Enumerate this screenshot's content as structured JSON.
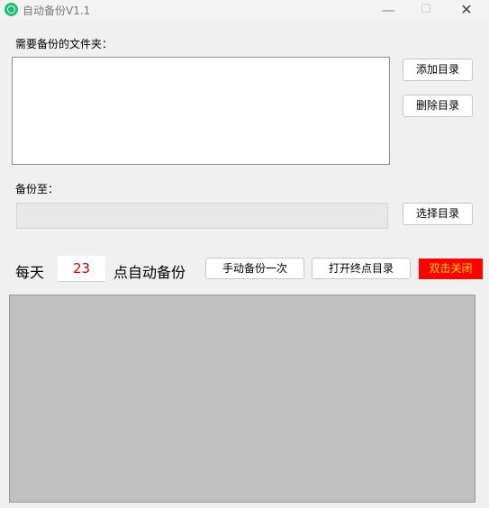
{
  "window": {
    "title": "自动备份V1.1",
    "minimize_glyph": "—",
    "maximize_glyph": "☐",
    "close_glyph": "✕"
  },
  "source": {
    "label": "需要备份的文件夹：",
    "add_button": "添加目录",
    "delete_button": "删除目录"
  },
  "destination": {
    "label": "备份至：",
    "path_value": "",
    "select_button": "选择目录"
  },
  "schedule": {
    "prefix": "每天",
    "hour_value": "23",
    "suffix": "点自动备份",
    "manual_button": "手动备份一次",
    "open_dest_button": "打开终点目录",
    "close_button": "双击关闭"
  },
  "colors": {
    "app_icon": "#1fbf73",
    "hour_text": "#d40000",
    "close_button_bg": "#ff0000",
    "close_button_text": "#ffd800",
    "log_bg": "#c0c0c0"
  },
  "icons": {
    "app": "app-logo-icon"
  }
}
